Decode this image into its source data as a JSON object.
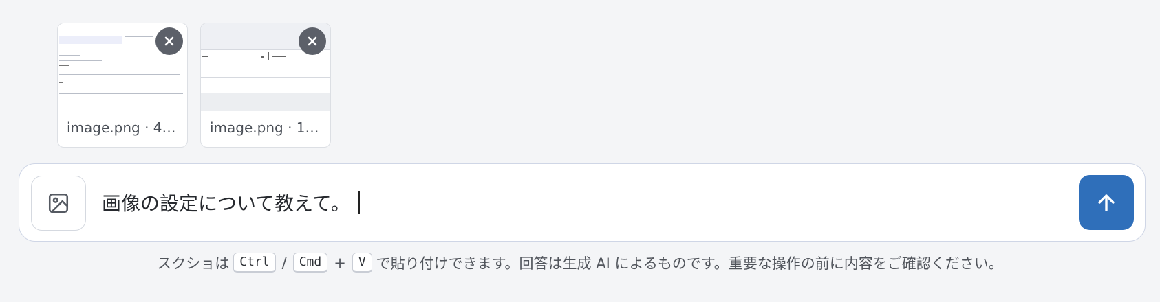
{
  "attachments": [
    {
      "caption": "image.png · 4…",
      "remove_icon": "close-icon"
    },
    {
      "caption": "image.png · 1…",
      "remove_icon": "close-icon"
    }
  ],
  "composer": {
    "image_button_icon": "image-icon",
    "input_value": "画像の設定について教えて。",
    "send_icon": "arrow-up-icon"
  },
  "footer": {
    "prefix": "スクショは",
    "key_ctrl": "Ctrl",
    "slash": "/",
    "key_cmd": "Cmd",
    "plus": "+",
    "key_v": "V",
    "suffix": "で貼り付けできます。回答は生成 AI によるものです。重要な操作の前に内容をご確認ください。"
  },
  "colors": {
    "background": "#f4f5f7",
    "send_button": "#2f6fba",
    "remove_button": "#5c6069",
    "composer_border": "#cfd6e6"
  }
}
